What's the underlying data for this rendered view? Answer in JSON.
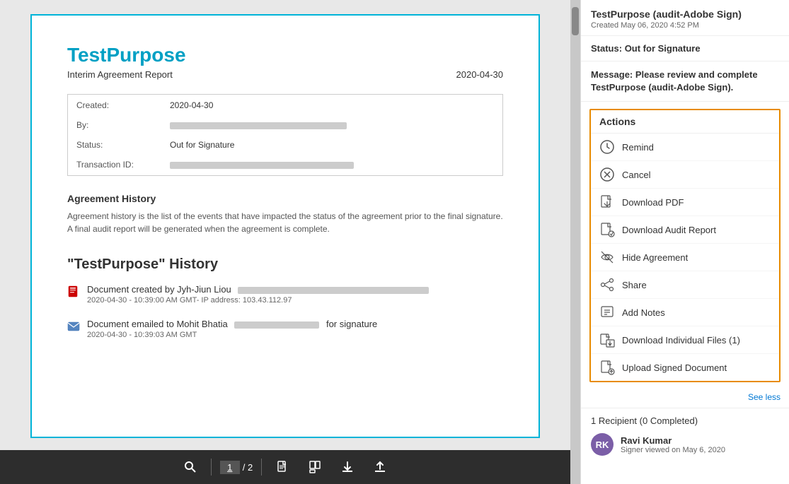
{
  "document": {
    "title": "TestPurpose",
    "subtitle": "Interim Agreement Report",
    "date": "2020-04-30",
    "meta": {
      "created_label": "Created:",
      "created_value": "2020-04-30",
      "by_label": "By:",
      "status_label": "Status:",
      "status_value": "Out for Signature",
      "transaction_label": "Transaction ID:"
    },
    "agreement_history": {
      "title": "Agreement History",
      "description": "Agreement history is the list of the events that have impacted the status of the agreement prior to the final signature. A final audit report will be generated when the agreement is complete."
    },
    "history_section_title": "\"TestPurpose\" History",
    "history_items": [
      {
        "id": "item-created",
        "text": "Document created by Jyh-Jiun Liou",
        "date": "2020-04-30 - 10:39:00 AM GMT- IP address: 103.43.112.97"
      },
      {
        "id": "item-emailed",
        "text": "Document emailed to Mohit Bhatia",
        "suffix": "for signature",
        "date": "2020-04-30 - 10:39:03 AM GMT"
      }
    ]
  },
  "toolbar": {
    "current_page": "1",
    "total_pages": "/ 2"
  },
  "right_panel": {
    "title": "TestPurpose (audit-Adobe Sign)",
    "created": "Created May 06, 2020 4:52 PM",
    "status_label": "Status:",
    "status_value": "Out for Signature",
    "message_label": "Message:",
    "message_value": "Please review and complete TestPurpose (audit-Adobe Sign).",
    "actions_title": "Actions",
    "actions": [
      {
        "id": "remind",
        "label": "Remind",
        "icon": "remind"
      },
      {
        "id": "cancel",
        "label": "Cancel",
        "icon": "cancel"
      },
      {
        "id": "download-pdf",
        "label": "Download PDF",
        "icon": "pdf"
      },
      {
        "id": "download-audit",
        "label": "Download Audit Report",
        "icon": "audit"
      },
      {
        "id": "hide-agreement",
        "label": "Hide Agreement",
        "icon": "hide"
      },
      {
        "id": "share",
        "label": "Share",
        "icon": "share"
      },
      {
        "id": "add-notes",
        "label": "Add Notes",
        "icon": "notes"
      },
      {
        "id": "download-individual",
        "label": "Download Individual Files (1)",
        "icon": "download-files"
      },
      {
        "id": "upload-signed",
        "label": "Upload Signed Document",
        "icon": "upload"
      }
    ],
    "see_less": "See less",
    "recipient_section_title": "1 Recipient (0 Completed)",
    "recipient": {
      "name": "Ravi Kumar",
      "initials": "RK",
      "viewed": "Signer viewed on May 6, 2020"
    }
  }
}
